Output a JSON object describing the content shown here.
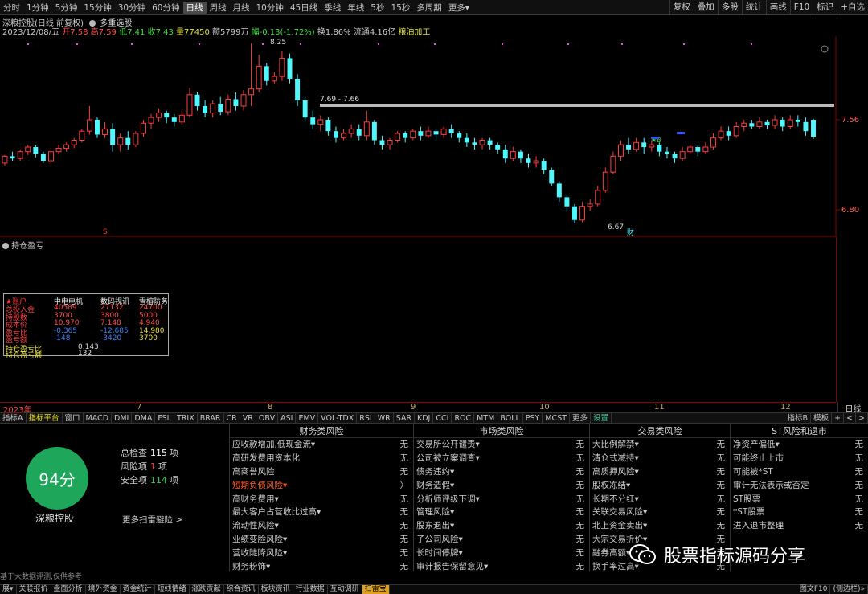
{
  "top_periods": [
    "分时",
    "1分钟",
    "5分钟",
    "15分钟",
    "30分钟",
    "60分钟",
    "日线",
    "周线",
    "月线",
    "10分钟",
    "45日线",
    "季线",
    "年线",
    "5秒",
    "15秒",
    "多周期",
    "更多▾"
  ],
  "active_period": "日线",
  "top_right": [
    "复权",
    "叠加",
    "多股",
    "统计",
    "画线",
    "F10",
    "标记",
    "+自选"
  ],
  "stock": {
    "title": "深粮控股(日线 前复权)",
    "layer_label": "多重选股",
    "date": "2023/12/08/五",
    "open_label": "开",
    "open": "7.58",
    "high_label": "高",
    "high": "7.59",
    "low_label": "低",
    "low": "7.41",
    "close_label": "收",
    "close": "7.43",
    "vol_label": "量",
    "vol": "77450",
    "amt_label": "额",
    "amt": "5799万",
    "chg_label": "幅",
    "chg": "-0.13(-1.72%)",
    "turnover": "换1.86%",
    "float": "流通4.16亿",
    "industry": "粮油加工"
  },
  "chart_marks": {
    "high_label": "8.25",
    "low_label": "6.67",
    "range_label": "7.69 - 7.66",
    "y_ticks": [
      "7.56",
      "6.80"
    ],
    "s_marker": "S",
    "cai_marker": "财",
    "star_marker": "★B"
  },
  "chart_data": {
    "type": "candlestick",
    "y_ticks": [
      7.56,
      6.8
    ],
    "candles": [
      [
        7.2,
        7.26,
        7.18,
        7.27
      ],
      [
        7.26,
        7.24,
        7.22,
        7.3
      ],
      [
        7.24,
        7.3,
        7.22,
        7.32
      ],
      [
        7.3,
        7.34,
        7.27,
        7.36
      ],
      [
        7.34,
        7.28,
        7.25,
        7.36
      ],
      [
        7.28,
        7.22,
        7.2,
        7.3
      ],
      [
        7.22,
        7.3,
        7.2,
        7.32
      ],
      [
        7.3,
        7.33,
        7.28,
        7.36
      ],
      [
        7.33,
        7.36,
        7.3,
        7.38
      ],
      [
        7.36,
        7.4,
        7.33,
        7.42
      ],
      [
        7.4,
        7.48,
        7.38,
        7.5
      ],
      [
        7.48,
        7.58,
        7.45,
        7.7
      ],
      [
        7.58,
        7.45,
        7.42,
        7.6
      ],
      [
        7.45,
        7.5,
        7.42,
        7.56
      ],
      [
        7.5,
        7.36,
        7.3,
        7.55
      ],
      [
        7.36,
        7.42,
        7.3,
        7.46
      ],
      [
        7.42,
        7.36,
        7.32,
        7.48
      ],
      [
        7.36,
        7.46,
        7.34,
        7.48
      ],
      [
        7.46,
        7.55,
        7.43,
        7.58
      ],
      [
        7.55,
        7.6,
        7.5,
        7.63
      ],
      [
        7.6,
        7.64,
        7.56,
        7.68
      ],
      [
        7.64,
        7.6,
        7.55,
        7.66
      ],
      [
        7.6,
        7.56,
        7.52,
        7.63
      ],
      [
        7.56,
        7.62,
        7.54,
        7.66
      ],
      [
        7.62,
        7.8,
        7.6,
        7.86
      ],
      [
        7.8,
        7.7,
        7.66,
        7.82
      ],
      [
        7.7,
        7.64,
        7.6,
        7.75
      ],
      [
        7.64,
        7.72,
        7.6,
        7.75
      ],
      [
        7.72,
        7.65,
        7.62,
        7.78
      ],
      [
        7.65,
        7.76,
        7.62,
        7.8
      ],
      [
        7.76,
        7.7,
        7.66,
        7.82
      ],
      [
        7.7,
        7.8,
        7.66,
        7.84
      ],
      [
        7.8,
        7.85,
        7.7,
        8.25
      ],
      [
        7.85,
        8.05,
        7.82,
        8.15
      ],
      [
        8.05,
        7.92,
        7.88,
        8.08
      ],
      [
        7.92,
        7.96,
        7.9,
        8.0
      ],
      [
        7.96,
        8.12,
        7.92,
        8.18
      ],
      [
        8.12,
        7.94,
        7.9,
        8.16
      ],
      [
        7.94,
        7.75,
        7.7,
        7.98
      ],
      [
        7.75,
        7.6,
        7.56,
        7.78
      ],
      [
        7.6,
        7.54,
        7.5,
        7.66
      ],
      [
        7.54,
        7.58,
        7.48,
        7.62
      ],
      [
        7.58,
        7.48,
        7.44,
        7.6
      ],
      [
        7.48,
        7.42,
        7.38,
        7.52
      ],
      [
        7.42,
        7.46,
        7.4,
        7.5
      ],
      [
        7.46,
        7.5,
        7.42,
        7.54
      ],
      [
        7.5,
        7.44,
        7.4,
        7.54
      ],
      [
        7.44,
        7.56,
        7.4,
        7.66
      ],
      [
        7.56,
        7.4,
        7.36,
        7.58
      ],
      [
        7.4,
        7.36,
        7.32,
        7.44
      ],
      [
        7.36,
        7.4,
        7.32,
        7.42
      ],
      [
        7.4,
        7.46,
        7.38,
        7.48
      ],
      [
        7.46,
        7.42,
        7.38,
        7.48
      ],
      [
        7.42,
        7.48,
        7.4,
        7.5
      ],
      [
        7.48,
        7.44,
        7.4,
        7.52
      ],
      [
        7.44,
        7.48,
        7.42,
        7.52
      ],
      [
        7.48,
        7.45,
        7.4,
        7.5
      ],
      [
        7.45,
        7.5,
        7.42,
        7.52
      ],
      [
        7.5,
        7.46,
        7.42,
        7.54
      ],
      [
        7.46,
        7.42,
        7.38,
        7.48
      ],
      [
        7.42,
        7.38,
        7.34,
        7.46
      ],
      [
        7.38,
        7.36,
        7.32,
        7.42
      ],
      [
        7.36,
        7.4,
        7.32,
        7.42
      ],
      [
        7.4,
        7.36,
        7.32,
        7.42
      ],
      [
        7.36,
        7.32,
        7.28,
        7.38
      ],
      [
        7.32,
        7.24,
        7.2,
        7.36
      ],
      [
        7.24,
        7.3,
        7.22,
        7.34
      ],
      [
        7.3,
        7.24,
        7.2,
        7.32
      ],
      [
        7.24,
        7.2,
        7.16,
        7.28
      ],
      [
        7.2,
        7.22,
        7.16,
        7.26
      ],
      [
        7.22,
        7.14,
        7.1,
        7.24
      ],
      [
        7.14,
        7.02,
        7.0,
        7.16
      ],
      [
        7.02,
        6.9,
        6.86,
        7.04
      ],
      [
        6.9,
        6.82,
        6.78,
        6.92
      ],
      [
        6.82,
        6.7,
        6.67,
        6.84
      ],
      [
        6.7,
        6.82,
        6.68,
        6.86
      ],
      [
        6.82,
        6.84,
        6.78,
        6.88
      ],
      [
        6.84,
        6.96,
        6.82,
        7.0
      ],
      [
        6.96,
        7.12,
        6.94,
        7.16
      ],
      [
        7.12,
        7.26,
        7.1,
        7.3
      ],
      [
        7.26,
        7.36,
        7.22,
        7.4
      ],
      [
        7.36,
        7.32,
        7.28,
        7.42
      ],
      [
        7.32,
        7.38,
        7.3,
        7.42
      ],
      [
        7.38,
        7.34,
        7.28,
        7.42
      ],
      [
        7.34,
        7.36,
        7.3,
        7.4
      ],
      [
        7.36,
        7.3,
        7.26,
        7.38
      ],
      [
        7.3,
        7.28,
        7.24,
        7.34
      ],
      [
        7.28,
        7.24,
        7.2,
        7.3
      ],
      [
        7.24,
        7.3,
        7.22,
        7.34
      ],
      [
        7.3,
        7.34,
        7.28,
        7.36
      ],
      [
        7.34,
        7.3,
        7.26,
        7.36
      ],
      [
        7.3,
        7.34,
        7.28,
        7.38
      ],
      [
        7.34,
        7.42,
        7.32,
        7.46
      ],
      [
        7.42,
        7.48,
        7.4,
        7.52
      ],
      [
        7.48,
        7.44,
        7.4,
        7.52
      ],
      [
        7.44,
        7.52,
        7.42,
        7.56
      ],
      [
        7.52,
        7.55,
        7.48,
        7.58
      ],
      [
        7.55,
        7.52,
        7.5,
        7.58
      ],
      [
        7.52,
        7.56,
        7.5,
        7.6
      ],
      [
        7.56,
        7.53,
        7.5,
        7.58
      ],
      [
        7.53,
        7.58,
        7.5,
        7.62
      ],
      [
        7.58,
        7.52,
        7.48,
        7.6
      ],
      [
        7.52,
        7.58,
        7.5,
        7.62
      ],
      [
        7.58,
        7.56,
        7.52,
        7.62
      ],
      [
        7.56,
        7.48,
        7.44,
        7.6
      ],
      [
        7.58,
        7.43,
        7.41,
        7.59
      ]
    ]
  },
  "position_panel": {
    "title": "持仓盈亏",
    "header": [
      "★账户",
      "中电电机",
      "数码视讯",
      "雪榕防务"
    ],
    "rows": [
      {
        "label": "总投入金",
        "v": [
          "40589",
          "27132",
          "24700"
        ]
      },
      {
        "label": "持股数",
        "v": [
          "3700",
          "3800",
          "5000"
        ]
      },
      {
        "label": "成本价",
        "v": [
          "10.970",
          "7.148",
          "4.940"
        ]
      },
      {
        "label": "盈亏比",
        "v": [
          "-0.365",
          "-12.685",
          "14.980"
        ]
      },
      {
        "label": "盈亏额",
        "v": [
          "-148",
          "-3420",
          "3700"
        ]
      }
    ],
    "sum1_label": "持仓盈亏比:",
    "sum1": "0.143",
    "sum2_label": "持仓盈亏额:",
    "sum2": "132"
  },
  "date_axis": [
    "2023年",
    "7",
    "8",
    "9",
    "10",
    "11",
    "12"
  ],
  "period_label": "日线",
  "indicator_tabs": [
    "指标A",
    "指标平台",
    "窗口",
    "MACD",
    "DMI",
    "DMA",
    "FSL",
    "TRIX",
    "BRAR",
    "CR",
    "VR",
    "OBV",
    "ASI",
    "EMV",
    "VOL-TDX",
    "RSI",
    "WR",
    "SAR",
    "KDJ",
    "CCI",
    "ROC",
    "MTM",
    "BOLL",
    "PSY",
    "MCST",
    "更多",
    "设置"
  ],
  "indicator_right": [
    "指标B",
    "模板",
    "+",
    "<",
    ">"
  ],
  "scan": {
    "score": "94分",
    "name": "深粮控股",
    "total_label": "总检查",
    "total": "115",
    "risk_label": "风险项",
    "risk": "1",
    "safe_label": "安全项",
    "safe": "114",
    "unit": "项",
    "more": "更多扫雷避险 >",
    "footer": "基于大数据评测,仅供参考",
    "cols": [
      {
        "title": "财务类风险",
        "items": [
          [
            "应收款增加,低现金流▾",
            "无"
          ],
          [
            "高研发费用资本化",
            "无"
          ],
          [
            "高商誉风险",
            "无"
          ],
          [
            "短期负债风险▾",
            "〉"
          ],
          [
            "高财务费用▾",
            "无"
          ],
          [
            "最大客户占营收比过高▾",
            "无"
          ],
          [
            "流动性风险▾",
            "无"
          ],
          [
            "业绩变脸风险▾",
            "无"
          ],
          [
            "营收陡降风险▾",
            "无"
          ],
          [
            "财务粉饰▾",
            "无"
          ]
        ]
      },
      {
        "title": "市场类风险",
        "items": [
          [
            "交易所公开谴责▾",
            "无"
          ],
          [
            "公司被立案调查▾",
            "无"
          ],
          [
            "债务违约▾",
            "无"
          ],
          [
            "财务造假▾",
            "无"
          ],
          [
            "分析师评级下调▾",
            "无"
          ],
          [
            "管理风险▾",
            "无"
          ],
          [
            "股东退出▾",
            "无"
          ],
          [
            "子公司风险▾",
            "无"
          ],
          [
            "长时间停牌▾",
            "无"
          ],
          [
            "审计报告保留意见▾",
            "无"
          ]
        ]
      },
      {
        "title": "交易类风险",
        "items": [
          [
            "大比例解禁▾",
            "无"
          ],
          [
            "清仓式减持▾",
            "无"
          ],
          [
            "高质押风险▾",
            "无"
          ],
          [
            "股权冻结▾",
            "无"
          ],
          [
            "长期不分红▾",
            "无"
          ],
          [
            "关联交易风险▾",
            "无"
          ],
          [
            "北上资金卖出▾",
            "无"
          ],
          [
            "大宗交易折价▾",
            "无"
          ],
          [
            "融券高额▾",
            "无"
          ],
          [
            "换手率过高▾",
            "无"
          ]
        ]
      },
      {
        "title": "ST风险和退市",
        "items": [
          [
            "净资产偏低▾",
            "无"
          ],
          [
            "可能终止上市",
            "无"
          ],
          [
            "可能被*ST",
            "无"
          ],
          [
            "审计无法表示或否定",
            "无"
          ],
          [
            "ST股票",
            "无"
          ],
          [
            "*ST股票",
            "无"
          ],
          [
            "进入退市整理",
            "无"
          ]
        ]
      }
    ]
  },
  "bottom_tabs": [
    "展▾",
    "关联报价",
    "盘面分析",
    "境外资金",
    "资金统计",
    "短线情绪",
    "涨跌贡献",
    "综合资讯",
    "板块资讯",
    "行业数据",
    "互动调研",
    "扫雷宝"
  ],
  "bottom_active": "扫雷宝",
  "bottom_right": [
    "图文F10",
    "(侧边栏)»"
  ],
  "watermark": "股票指标源码分享",
  "colors": {
    "up": "#ff3c3c",
    "down": "#4ff7ff",
    "grid": "#8a0000",
    "score": "#1ea75a"
  }
}
